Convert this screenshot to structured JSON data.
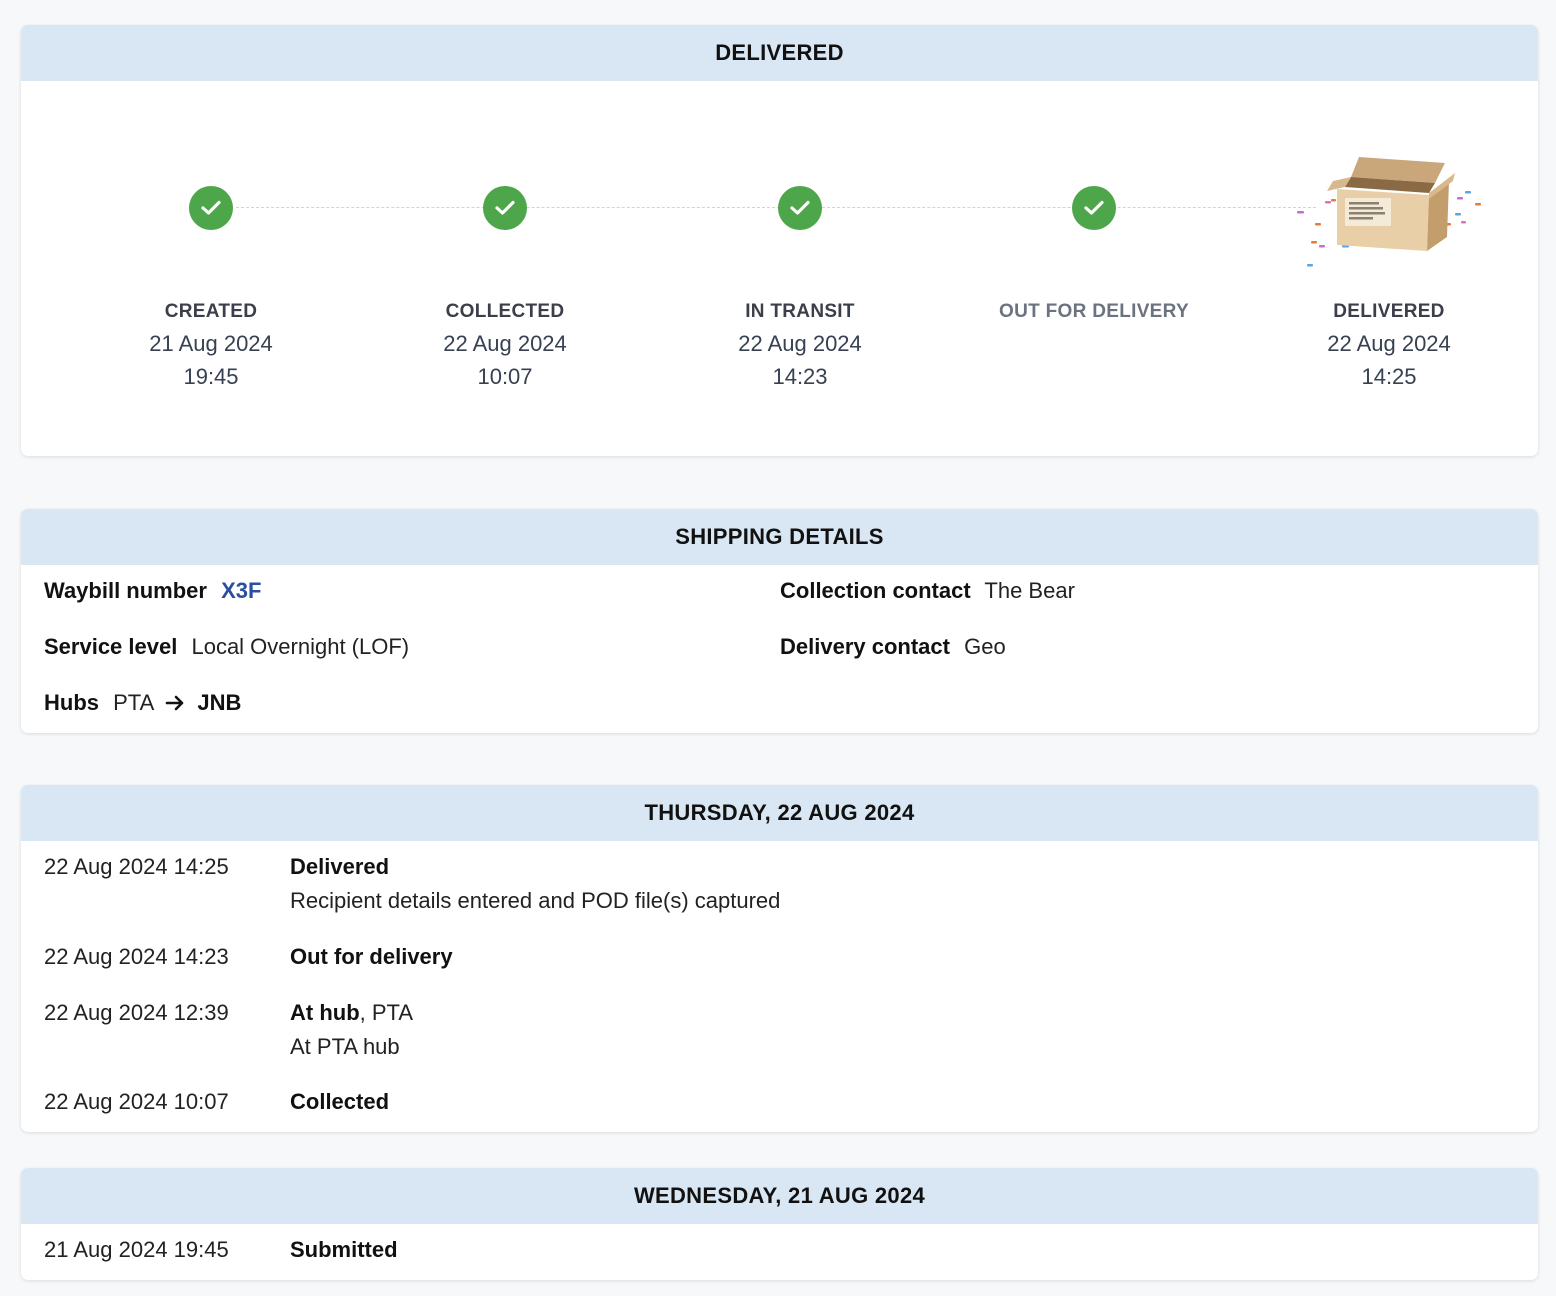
{
  "status": {
    "header": "DELIVERED",
    "steps": [
      {
        "label": "CREATED",
        "date": "21 Aug 2024",
        "time": "19:45",
        "icon": "check-icon"
      },
      {
        "label": "COLLECTED",
        "date": "22 Aug 2024",
        "time": "10:07",
        "icon": "check-icon"
      },
      {
        "label": "IN TRANSIT",
        "date": "22 Aug 2024",
        "time": "14:23",
        "icon": "check-icon"
      },
      {
        "label": "OUT FOR DELIVERY",
        "date": "",
        "time": "",
        "icon": "check-icon"
      },
      {
        "label": "DELIVERED",
        "date": "22 Aug 2024",
        "time": "14:25",
        "icon": "open-box-icon"
      }
    ]
  },
  "shipping": {
    "header": "SHIPPING DETAILS",
    "waybill_label": "Waybill number",
    "waybill_value": "X3F",
    "service_label": "Service level",
    "service_value": "Local Overnight (LOF)",
    "hubs_label": "Hubs",
    "hub_from": "PTA",
    "hub_to": "JNB",
    "collection_label": "Collection contact",
    "collection_value": "The Bear",
    "delivery_label": "Delivery contact",
    "delivery_value": "Geo"
  },
  "timeline": [
    {
      "header": "THURSDAY, 22 AUG 2024",
      "events": [
        {
          "ts": "22 Aug 2024 14:25",
          "title": "Delivered",
          "suffix": "",
          "sub": "Recipient details entered and POD file(s) captured"
        },
        {
          "ts": "22 Aug 2024 14:23",
          "title": "Out for delivery",
          "suffix": "",
          "sub": ""
        },
        {
          "ts": "22 Aug 2024 12:39",
          "title": "At hub",
          "suffix": ", PTA",
          "sub": "At PTA hub"
        },
        {
          "ts": "22 Aug 2024 10:07",
          "title": "Collected",
          "suffix": "",
          "sub": ""
        }
      ]
    },
    {
      "header": "WEDNESDAY, 21 AUG 2024",
      "events": [
        {
          "ts": "21 Aug 2024 19:45",
          "title": "Submitted",
          "suffix": "",
          "sub": ""
        }
      ]
    }
  ],
  "colors": {
    "header_bg": "#d9e6f3",
    "check_green": "#4ea64b",
    "waybill_blue": "#2b4fa0"
  }
}
